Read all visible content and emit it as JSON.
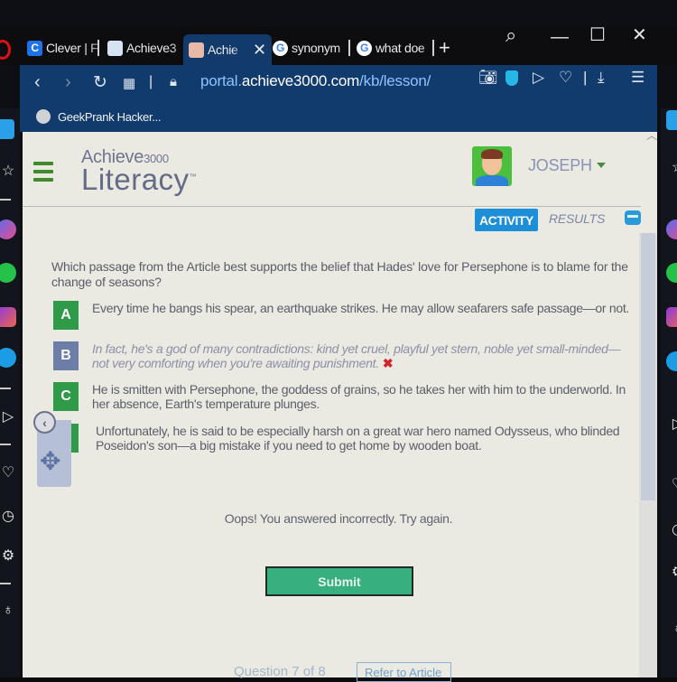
{
  "browser": {
    "tabs": [
      {
        "label": "Clever | F",
        "favicon": "C",
        "favicon_color": "#1e73e8",
        "active": false
      },
      {
        "label": "Achieve3",
        "favicon": "achieve-icon",
        "favicon_color": "#d5e3f2",
        "active": false
      },
      {
        "label": "Achie",
        "favicon": "achieve-logo",
        "favicon_color": "#e9b9a8",
        "active": true
      },
      {
        "label": "synonym",
        "favicon": "G",
        "favicon_color": "#ffffff",
        "active": false
      },
      {
        "label": "what doe",
        "favicon": "G",
        "favicon_color": "#ffffff",
        "active": false
      }
    ],
    "new_tab_label": "+",
    "close_tab_label": "✕",
    "url_prefix": "portal.",
    "url_domain": "achieve3000.com",
    "url_path": "/kb/lesson/",
    "bookmark_label": "GeekPrank Hacker...",
    "window_controls": {
      "search": "⌕",
      "minimize": "—",
      "maximize": "☐",
      "close": "✕"
    },
    "toolbar_icons": [
      "camera-icon",
      "shield-icon",
      "send-icon",
      "heart-icon",
      "download-icon",
      "settings-sliders-icon"
    ]
  },
  "sidebar_icons": [
    "home-icon",
    "star-icon",
    "messenger-icon",
    "whatsapp-icon",
    "instagram-icon",
    "twitter-icon",
    "send-icon",
    "heart-icon",
    "clock-icon",
    "gear-icon",
    "bulb-icon"
  ],
  "app": {
    "brand_top": "Achieve",
    "brand_top_suffix": "3000",
    "brand_main": "Literacy",
    "user_name": "JOSEPH",
    "tabs": {
      "activity": "ACTIVITY",
      "results": "RESULTS"
    }
  },
  "question": {
    "text": "Which passage from the Article best supports the belief that Hades' love for Persephone is to blame for the change of seasons?",
    "options": [
      {
        "letter": "A",
        "text": "Every time he bangs his spear, an earthquake strikes. He may allow seafarers safe passage—or not.",
        "state": "default"
      },
      {
        "letter": "B",
        "text": "In fact, he's a god of many contradictions: kind yet cruel, playful yet stern, noble yet small-minded—not very comforting when you're awaiting punishment.",
        "state": "incorrect",
        "mark": "✖"
      },
      {
        "letter": "C",
        "text": "He is smitten with Persephone, the goddess of grains, so he takes her with him to the underworld. In her absence, Earth's temperature plunges.",
        "state": "default"
      },
      {
        "letter": "D",
        "text": "Unfortunately, he is said to be especially harsh on a great war hero named Odysseus, who blinded Poseidon's son—a big mistake if you need to get home by wooden boat.",
        "state": "default"
      }
    ],
    "feedback": "Oops! You answered incorrectly. Try again.",
    "submit_label": "Submit",
    "progress_label": "Question 7 of 8",
    "refer_label": "Refer to Article"
  },
  "colors": {
    "accent_green": "#2f9a47",
    "activity_blue": "#1d8fd9",
    "submit_green": "#38b07e",
    "incorrect_red": "#d3222a"
  }
}
